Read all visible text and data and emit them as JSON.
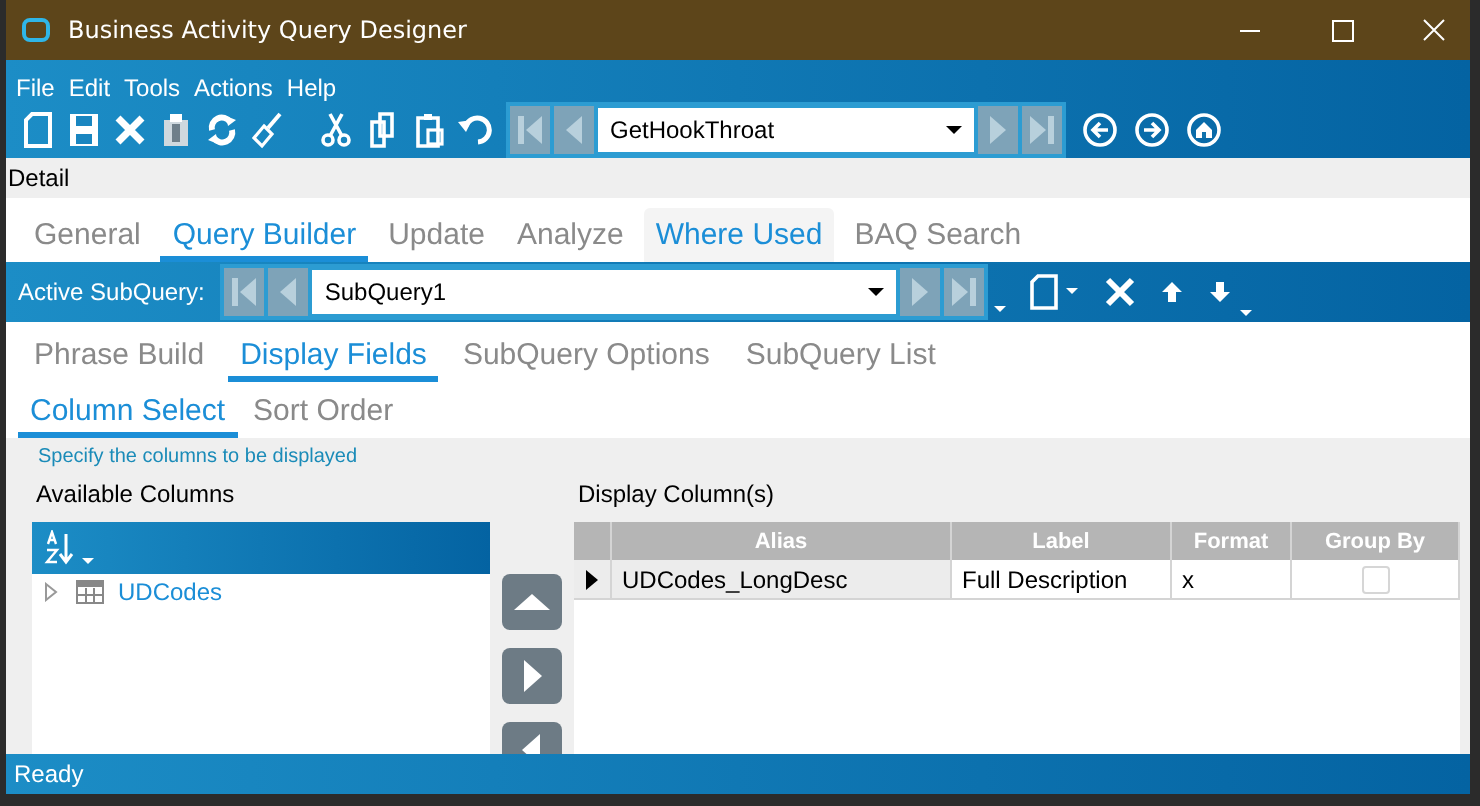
{
  "window": {
    "title": "Business Activity Query Designer"
  },
  "menu": [
    "File",
    "Edit",
    "Tools",
    "Actions",
    "Help"
  ],
  "toolbar": {
    "record": "GetHookThroat"
  },
  "section": "Detail",
  "tabs": [
    {
      "label": "General",
      "selected": false,
      "hovered": false
    },
    {
      "label": "Query Builder",
      "selected": true,
      "hovered": false
    },
    {
      "label": "Update",
      "selected": false,
      "hovered": false
    },
    {
      "label": "Analyze",
      "selected": false,
      "hovered": false
    },
    {
      "label": "Where Used",
      "selected": false,
      "hovered": true
    },
    {
      "label": "BAQ Search",
      "selected": false,
      "hovered": false
    }
  ],
  "subquery_bar": {
    "label": "Active SubQuery:",
    "value": "SubQuery1"
  },
  "subtabs": [
    {
      "label": "Phrase Build",
      "selected": false
    },
    {
      "label": "Display Fields",
      "selected": true
    },
    {
      "label": "SubQuery Options",
      "selected": false
    },
    {
      "label": "SubQuery List",
      "selected": false
    }
  ],
  "column_tabs": [
    {
      "label": "Column Select",
      "selected": true
    },
    {
      "label": "Sort Order",
      "selected": false
    }
  ],
  "hint": "Specify the columns to be displayed",
  "available": {
    "title": "Available Columns",
    "tree": [
      {
        "label": "UDCodes",
        "expanded": false
      }
    ]
  },
  "display": {
    "title": "Display Column(s)",
    "columns": [
      "Alias",
      "Label",
      "Format",
      "Group By"
    ],
    "rows": [
      {
        "current": true,
        "alias": "UDCodes_LongDesc",
        "label": "Full Description",
        "format": "x",
        "group_by": false
      }
    ]
  },
  "status_bar": "Ready"
}
